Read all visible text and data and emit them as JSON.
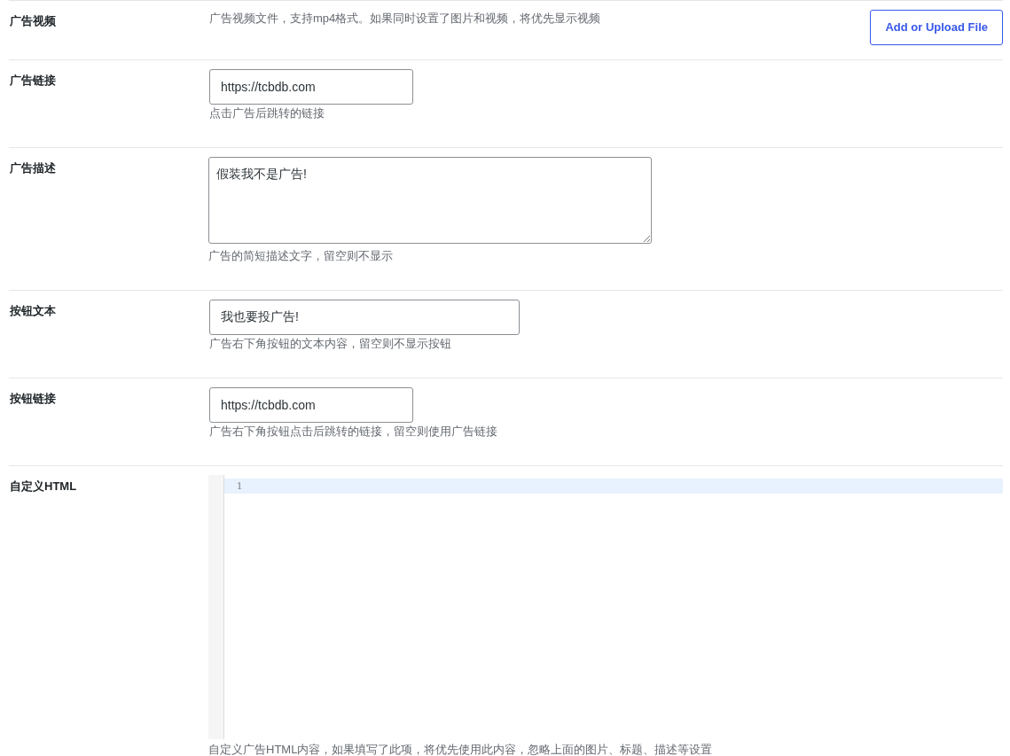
{
  "fields": [
    {
      "kind": "upload",
      "label": "广告视频",
      "description": "广告视频文件，支持mp4格式。如果同时设置了图片和视频，将优先显示视频",
      "button": "Add or Upload File"
    },
    {
      "kind": "url",
      "label": "广告链接",
      "value": "https://tcbdb.com",
      "description": "点击广告后跳转的链接"
    },
    {
      "kind": "textarea",
      "label": "广告描述",
      "value": "假装我不是广告!",
      "description": "广告的简短描述文字，留空则不显示"
    },
    {
      "kind": "text",
      "label": "按钮文本",
      "value": "我也要投广告!",
      "description": "广告右下角按钮的文本内容，留空则不显示按钮"
    },
    {
      "kind": "url",
      "label": "按钮链接",
      "value": "https://tcbdb.com",
      "description": "广告右下角按钮点击后跳转的链接，留空则使用广告链接"
    },
    {
      "kind": "code",
      "label": "自定义HTML",
      "lines": [
        {
          "number": "1",
          "active": true
        }
      ],
      "description": "自定义广告HTML内容，如果填写了此项，将优先使用此内容，忽略上面的图片、标题、描述等设置"
    }
  ]
}
